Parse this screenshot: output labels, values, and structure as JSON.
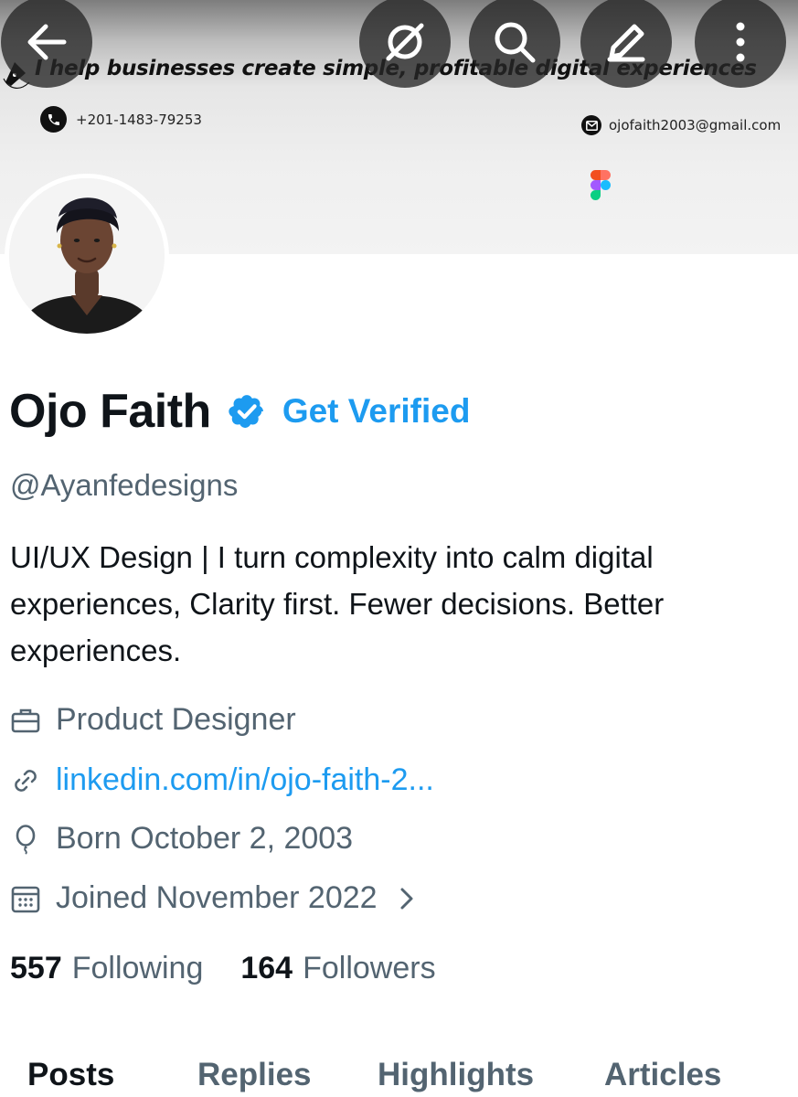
{
  "banner": {
    "tagline": "I help businesses create simple, profitable digital experiences",
    "phone": "+201-1483-79253",
    "email": "ojofaith2003@gmail.com"
  },
  "nav": {
    "back_icon": "arrow-left-icon",
    "grok_icon": "grok-icon",
    "search_icon": "search-icon",
    "edit_icon": "pencil-icon",
    "more_icon": "more-vertical-icon"
  },
  "profile": {
    "name": "Ojo Faith",
    "get_verified": "Get Verified",
    "handle": "@Ayanfedesigns",
    "bio": "UI/UX Design | I turn complexity into calm digital experiences, Clarity first. Fewer decisions. Better experiences.",
    "job": "Product Designer",
    "link": "linkedin.com/in/ojo-faith-2...",
    "born": "Born October 2, 2003",
    "joined": "Joined November 2022",
    "following_count": "557",
    "following_label": "Following",
    "followers_count": "164",
    "followers_label": "Followers"
  },
  "tabs": [
    {
      "label": "Posts"
    },
    {
      "label": "Replies"
    },
    {
      "label": "Highlights"
    },
    {
      "label": "Articles"
    }
  ],
  "colors": {
    "accent": "#1d9bf0",
    "text": "#0f1419",
    "muted": "#536471"
  }
}
